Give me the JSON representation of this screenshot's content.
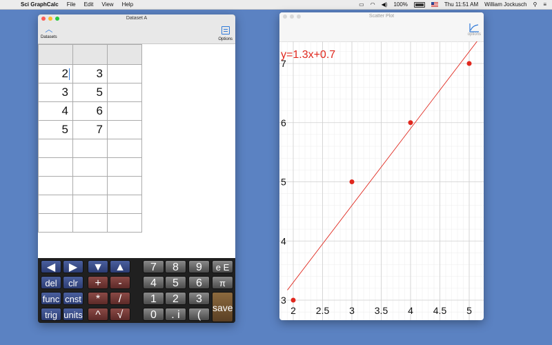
{
  "menubar": {
    "app": "Sci GraphCalc",
    "items": [
      "File",
      "Edit",
      "View",
      "Help"
    ],
    "battery": "100%",
    "clock": "Thu 11:51 AM",
    "user": "William Jockusch"
  },
  "dataset_window": {
    "title": "Dataset A",
    "left_button": "Datasets",
    "right_button": "Options",
    "rows": [
      [
        "2",
        "3",
        ""
      ],
      [
        "3",
        "5",
        ""
      ],
      [
        "4",
        "6",
        ""
      ],
      [
        "5",
        "7",
        ""
      ],
      [
        "",
        "",
        ""
      ],
      [
        "",
        "",
        ""
      ],
      [
        "",
        "",
        ""
      ],
      [
        "",
        "",
        ""
      ],
      [
        "",
        "",
        ""
      ]
    ]
  },
  "keypad": {
    "arrows": [
      "◀",
      "▶",
      "▼",
      "▲"
    ],
    "row2": [
      "del",
      "clr",
      "+",
      "-"
    ],
    "row3": [
      "func",
      "cnst",
      "*",
      "/"
    ],
    "row4": [
      "trig",
      "units",
      "^",
      "√"
    ],
    "digits": [
      [
        "7",
        "8",
        "9",
        "e E"
      ],
      [
        "4",
        "5",
        "6",
        "π"
      ],
      [
        "1",
        "2",
        "3"
      ],
      [
        "0",
        ". i",
        "("
      ]
    ],
    "save": "save"
  },
  "scatter_window": {
    "title": "Scatter Plot",
    "options_label": "options"
  },
  "chart_data": {
    "type": "scatter",
    "title": "",
    "equation": "y=1.3x+0.7",
    "xlabel": "",
    "ylabel": "",
    "x": [
      2,
      3,
      4,
      5
    ],
    "y": [
      3,
      5,
      6,
      7
    ],
    "fit": {
      "slope": 1.3,
      "intercept": 0.7
    },
    "xlim": [
      2,
      5
    ],
    "ylim": [
      3,
      7
    ],
    "x_ticks": [
      "2",
      "2.5",
      "3",
      "3.5",
      "4",
      "4.5",
      "5"
    ],
    "y_ticks": [
      "3",
      "4",
      "5",
      "6",
      "7"
    ],
    "grid": true,
    "colors": {
      "points": "#e0281e",
      "line": "#e0281e",
      "grid_major": "#cfcfcf",
      "grid_minor": "#ececec"
    }
  }
}
